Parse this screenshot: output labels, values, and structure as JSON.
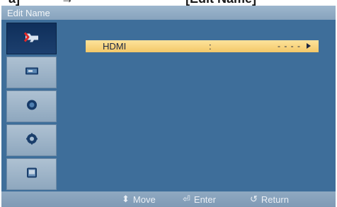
{
  "header_fragments": {
    "left": "a]",
    "mid": "→",
    "right": "[Edit Name]"
  },
  "osd": {
    "title": "Edit Name",
    "sidebar": [
      {
        "name": "input-icon",
        "active": true
      },
      {
        "name": "picture-icon",
        "active": false
      },
      {
        "name": "sound-icon",
        "active": false
      },
      {
        "name": "setup-icon",
        "active": false
      },
      {
        "name": "multi-control-icon",
        "active": false
      }
    ],
    "menu": {
      "label": "HDMI",
      "colon": ":",
      "value": "- - - -"
    },
    "footer": {
      "move": "Move",
      "enter": "Enter",
      "return": "Return",
      "move_icon": "updown-icon",
      "enter_icon": "enter-icon",
      "return_icon": "return-icon"
    }
  }
}
